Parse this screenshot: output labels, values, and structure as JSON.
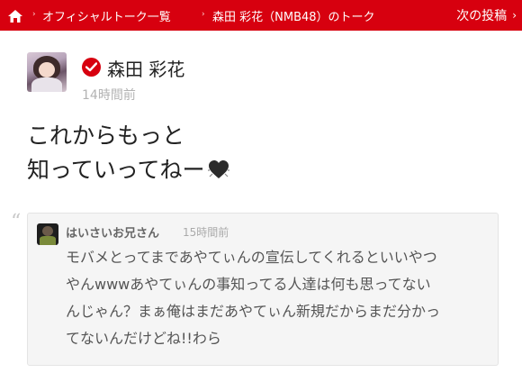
{
  "header": {
    "breadcrumbs": [
      "オフィシャルトーク一覧",
      "森田 彩花（NMB48）のトーク"
    ],
    "next_label": "次の投稿",
    "next_chevron": "›",
    "breadcrumb_separator": "›"
  },
  "post": {
    "author": "森田 彩花",
    "time": "14時間前",
    "message_lines": [
      "これからもっと",
      "知っていってねー"
    ]
  },
  "comment": {
    "quote_mark": "“",
    "author": "はいさいお兄さん",
    "time": "15時間前",
    "lines": [
      "モバメとってまであやてぃんの宣伝してくれるといいやつ",
      "やんwwwあやてぃんの事知ってる人達は何も思ってない",
      "んじゃん？まぁ俺はまだあやてぃん新規だからまだ分かっ",
      "てないんだけどね!!わら"
    ]
  },
  "colors": {
    "brand_red": "#d7000f",
    "muted_text": "#b3b3b3"
  }
}
